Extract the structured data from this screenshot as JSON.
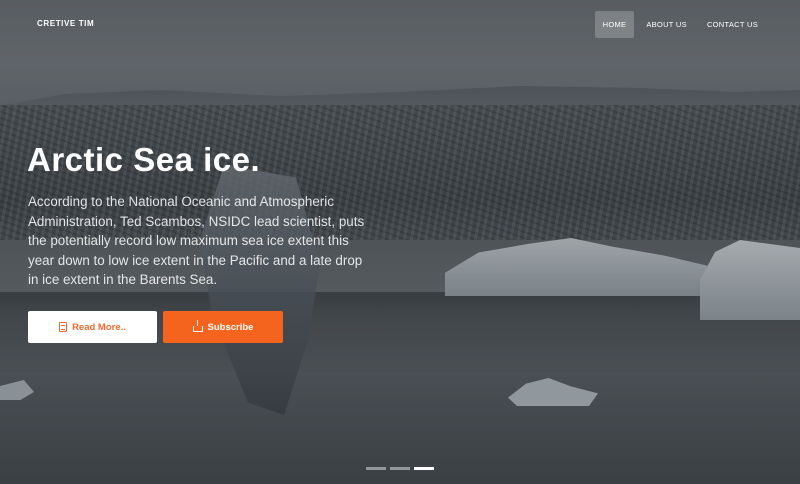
{
  "brand": "CRETIVE TIM",
  "nav": [
    {
      "label": "HOME",
      "active": true
    },
    {
      "label": "ABOUT US",
      "active": false
    },
    {
      "label": "CONTACT US",
      "active": false
    }
  ],
  "hero": {
    "title": "Arctic Sea ice.",
    "text": "According to the National Oceanic and Atmospheric Administration, Ted Scambos, NSIDC lead scientist, puts the potentially record low maximum sea ice extent this year down to low ice extent in the Pacific and a late drop in ice extent in the Barents Sea."
  },
  "buttons": {
    "read_more": {
      "label": "Read More..",
      "icon": "document-icon"
    },
    "subscribe": {
      "label": "Subscribe",
      "icon": "share-icon"
    }
  },
  "carousel": {
    "count": 3,
    "active_index": 2
  },
  "colors": {
    "accent": "#f4641e",
    "read_more_text": "#f06a2e"
  }
}
